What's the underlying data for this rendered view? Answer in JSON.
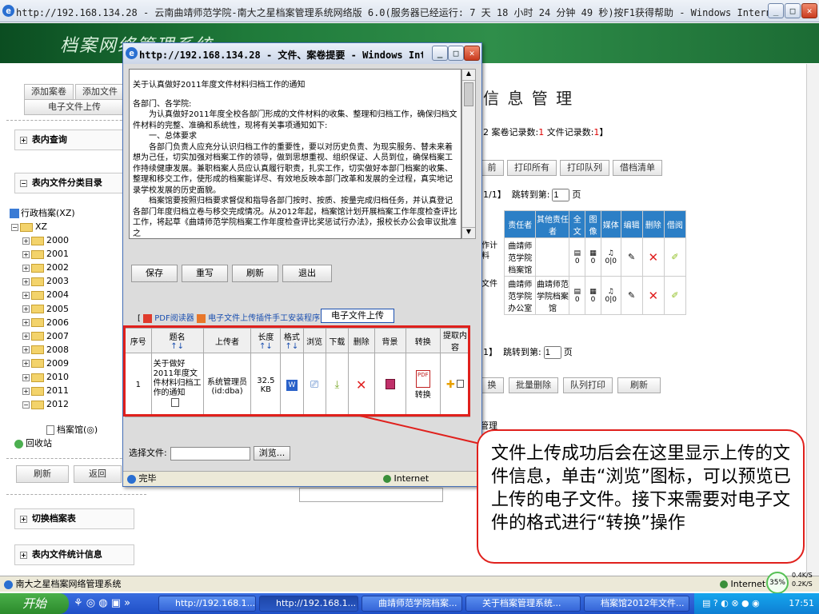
{
  "window": {
    "title": "http://192.168.134.28 - 云南曲靖师范学院-南大之星档案管理系统网络版 6.0(服务器已经运行: 7 天 18 小时 24 分钟 49 秒)按F1获得帮助 - Windows Internet Explorer",
    "icon": "ie-icon"
  },
  "app": {
    "logo": "档案网络管理系统"
  },
  "left": {
    "add_volume": "添加案卷",
    "add_file": "添加文件",
    "upload": "电子文件上传",
    "inner_query": "表内查询",
    "category_dir": "表内文件分类目录",
    "tree_root": "行政档案(XZ)",
    "tree_xz": "XZ",
    "years": [
      "2000",
      "2001",
      "2002",
      "2003",
      "2004",
      "2005",
      "2006",
      "2007",
      "2008",
      "2009",
      "2010",
      "2011",
      "2012"
    ],
    "archive_room": "档案馆(◎)",
    "recycle": "回收站",
    "refresh": "刷新",
    "back": "返回",
    "switch_table": "切换档案表",
    "stats": "表内文件统计信息"
  },
  "right": {
    "heading": "信 息 管 理",
    "records_prefix": "2 案卷记录数:",
    "records_volume": "1",
    "records_mid": " 文件记录数:",
    "records_file": "1",
    "records_suffix": "】",
    "btn_prev": "前",
    "btn_print_all": "打印所有",
    "btn_print_queue": "打印队列",
    "btn_borrow_list": "借档清单",
    "page_info": "1/1】",
    "jump_label": "跳转到第:",
    "jump_value": "1",
    "page_unit": "页",
    "table_headers": [
      "责任者",
      "其他责任者",
      "全文",
      "图像",
      "媒体",
      "编辑",
      "删除",
      "借阅"
    ],
    "rows": [
      {
        "title": "作计料",
        "owner": "曲靖师范学院档案馆",
        "other": "",
        "nums": [
          "0",
          "0",
          "0|0"
        ]
      },
      {
        "title": "文件",
        "owner": "曲靖师范学院办公室",
        "other": "曲靖师范学院档案馆",
        "nums": [
          "0",
          "0",
          "0|0"
        ]
      }
    ],
    "page_info2": "1】",
    "jump_label2": "跳转到第:",
    "jump_value2": "1",
    "page_unit2": "页",
    "btn_convert": "换",
    "btn_batch_delete": "批量删除",
    "btn_queue_print": "队列打印",
    "btn_refresh": "刷新",
    "manage": "管理"
  },
  "popup": {
    "title": "http://192.168.134.28 - 文件、案卷提要 - Windows Interne...",
    "doc_title": "关于认真做好2011年度文件材料归档工作的通知",
    "doc_lines": [
      "各部门、各学院:",
      "　　为认真做好2011年度全校各部门形成的文件材料的收集、整理和归档工作，确保归档文件材料的完整、准确和系统性，现将有关事项通知如下:",
      "　　一、总体要求",
      "　　各部门负责人应充分认识归档工作的重要性，要以对历史负责、为现实服务、替未来着想为己任，切实加强对档案工作的领导，做到思想重视、组织保证、人员到位，确保档案工作持续健康发展。兼职档案人员应认真履行职责，扎实工作，切实做好本部门档案的收集、整理和移交工作，使形成的档案能详尽、有效地反映本部门改革和发展的全过程，真实地记录学校发展的历史面貌。",
      "　　档案馆要按照归档要求督促和指导各部门按时、按质、按量完成归档任务，并认真登记各部门年度归档立卷与移交完成情况。从2012年起，档案馆计划开展档案工作年度检查评比工作，将起草《曲靖师范学院档案工作年度检查评比奖惩试行办法》，报校长办公会审议批准之"
    ],
    "btn_save": "保存",
    "btn_rewrite": "重写",
    "btn_refresh": "刷新",
    "btn_exit": "退出",
    "pdf_reader": "PDF阅读器",
    "plugin_link": "电子文件上传插件手工安装程序",
    "upload_button": "电子文件上传",
    "file_headers": [
      "序号",
      "题名",
      "上传者",
      "长度",
      "格式",
      "浏览",
      "下载",
      "删除",
      "背景",
      "转换",
      "提取内容"
    ],
    "sort_arrows": "↑↓",
    "file_row": {
      "index": "1",
      "title": "关于做好2011年度文件材料归档工作的通知",
      "uploader": "系统管理员(id:dba)",
      "size": "32.5 KB",
      "convert": "转换"
    },
    "select_file_label": "选择文件:",
    "browse": "浏览...",
    "status": "完毕",
    "zone": "Internet"
  },
  "callout": {
    "text": "文件上传成功后会在这里显示上传的文件信息，单击“浏览”图标，可以预览已上传的电子文件。接下来需要对电子文件的格式进行“转换”操作"
  },
  "statusbar": {
    "text": "南大之星档案网络管理系统",
    "zone": "Internet",
    "percent": "35%",
    "up": "0.4K/S",
    "down": "0.2K/S"
  },
  "taskbar": {
    "start": "开始",
    "items": [
      "http://192.168.1...",
      "http://192.168.1...",
      "曲靖师范学院档案...",
      "关于档案管理系统...",
      "档案馆2012年文件..."
    ],
    "clock": "17:51"
  },
  "colors": {
    "accent_red": "#e0201c",
    "header_green": "#1f7a3a",
    "table_blue": "#2c7fc6"
  }
}
